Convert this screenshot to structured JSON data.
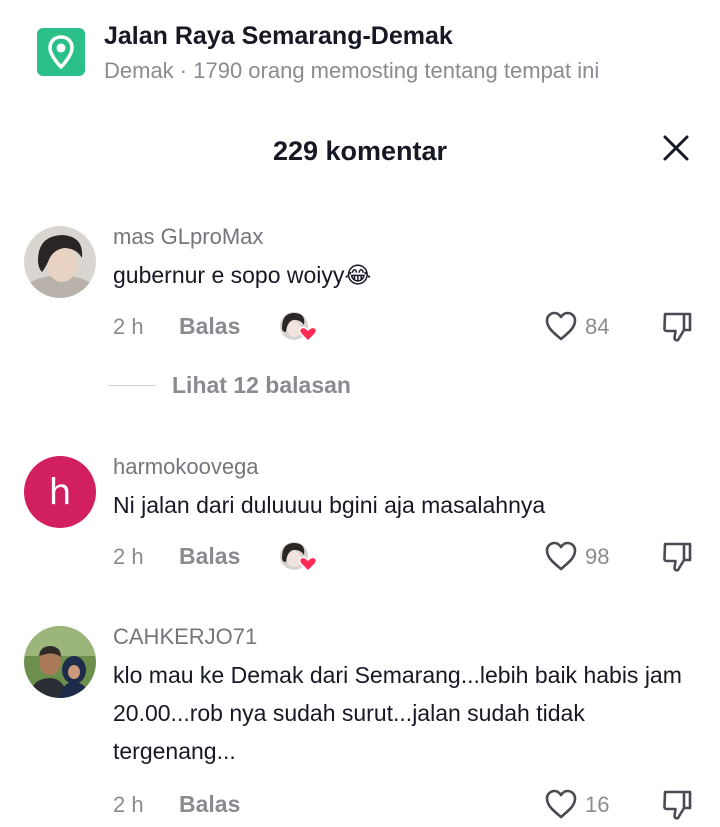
{
  "location": {
    "title": "Jalan Raya Semarang-Demak",
    "subtitle": "Demak · 1790 orang memosting tentang tempat ini",
    "icon": "location-pin-icon",
    "icon_color": "#2bbf8a"
  },
  "header": {
    "title": "229 komentar",
    "close_icon": "close-icon"
  },
  "comments": [
    {
      "username": "mas GLproMax",
      "text": "gubernur e sopo woiyy😂",
      "time": "2 h",
      "reply_label": "Balas",
      "likes": "84",
      "view_replies": "Lihat 12 balasan"
    },
    {
      "username": "harmokoovega",
      "avatar_letter": "h",
      "avatar_color": "#d21f5f",
      "text": "Ni jalan dari duluuuu bgini aja masalahnya",
      "time": "2 h",
      "reply_label": "Balas",
      "likes": "98"
    },
    {
      "username": "CAHKERJO71",
      "text": "klo mau ke Demak dari Semarang...lebih baik habis jam 20.00...rob nya sudah surut...jalan sudah tidak tergenang...",
      "time": "2 h",
      "reply_label": "Balas",
      "likes": "16"
    }
  ]
}
